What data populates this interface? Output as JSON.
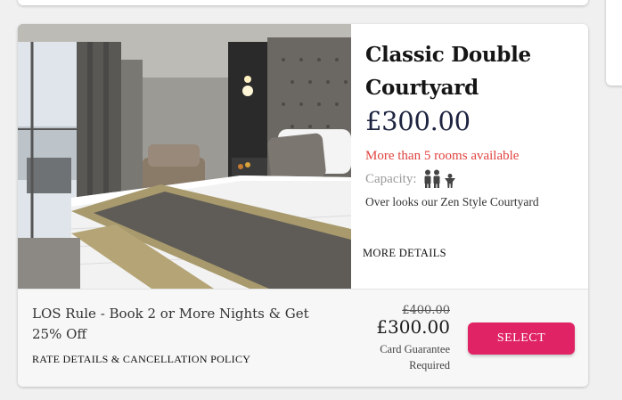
{
  "room": {
    "title_line1": "Classic Double",
    "title_line2": "Courtyard",
    "price": "£300.00",
    "availability": "More than 5 rooms available",
    "capacity_label": "Capacity:",
    "capacity_icons": [
      "adult-icon",
      "adult-icon",
      "child-icon"
    ],
    "description": "Over looks our Zen Style Courtyard",
    "more_details_label": "MORE DETAILS",
    "photo_icon": "hotel-room-photo"
  },
  "rate": {
    "name": "LOS Rule - Book 2 or More Nights & Get 25% Off",
    "policy_link": "RATE DETAILS & CANCELLATION POLICY",
    "original_price": "£400.00",
    "price": "£300.00",
    "guarantee_line1": "Card Guarantee",
    "guarantee_line2": "Required",
    "select_label": "SELECT"
  },
  "colors": {
    "accent": "#e02364",
    "availability": "#e0433f",
    "price": "#1d2340",
    "capacity_icon": "#444444"
  }
}
